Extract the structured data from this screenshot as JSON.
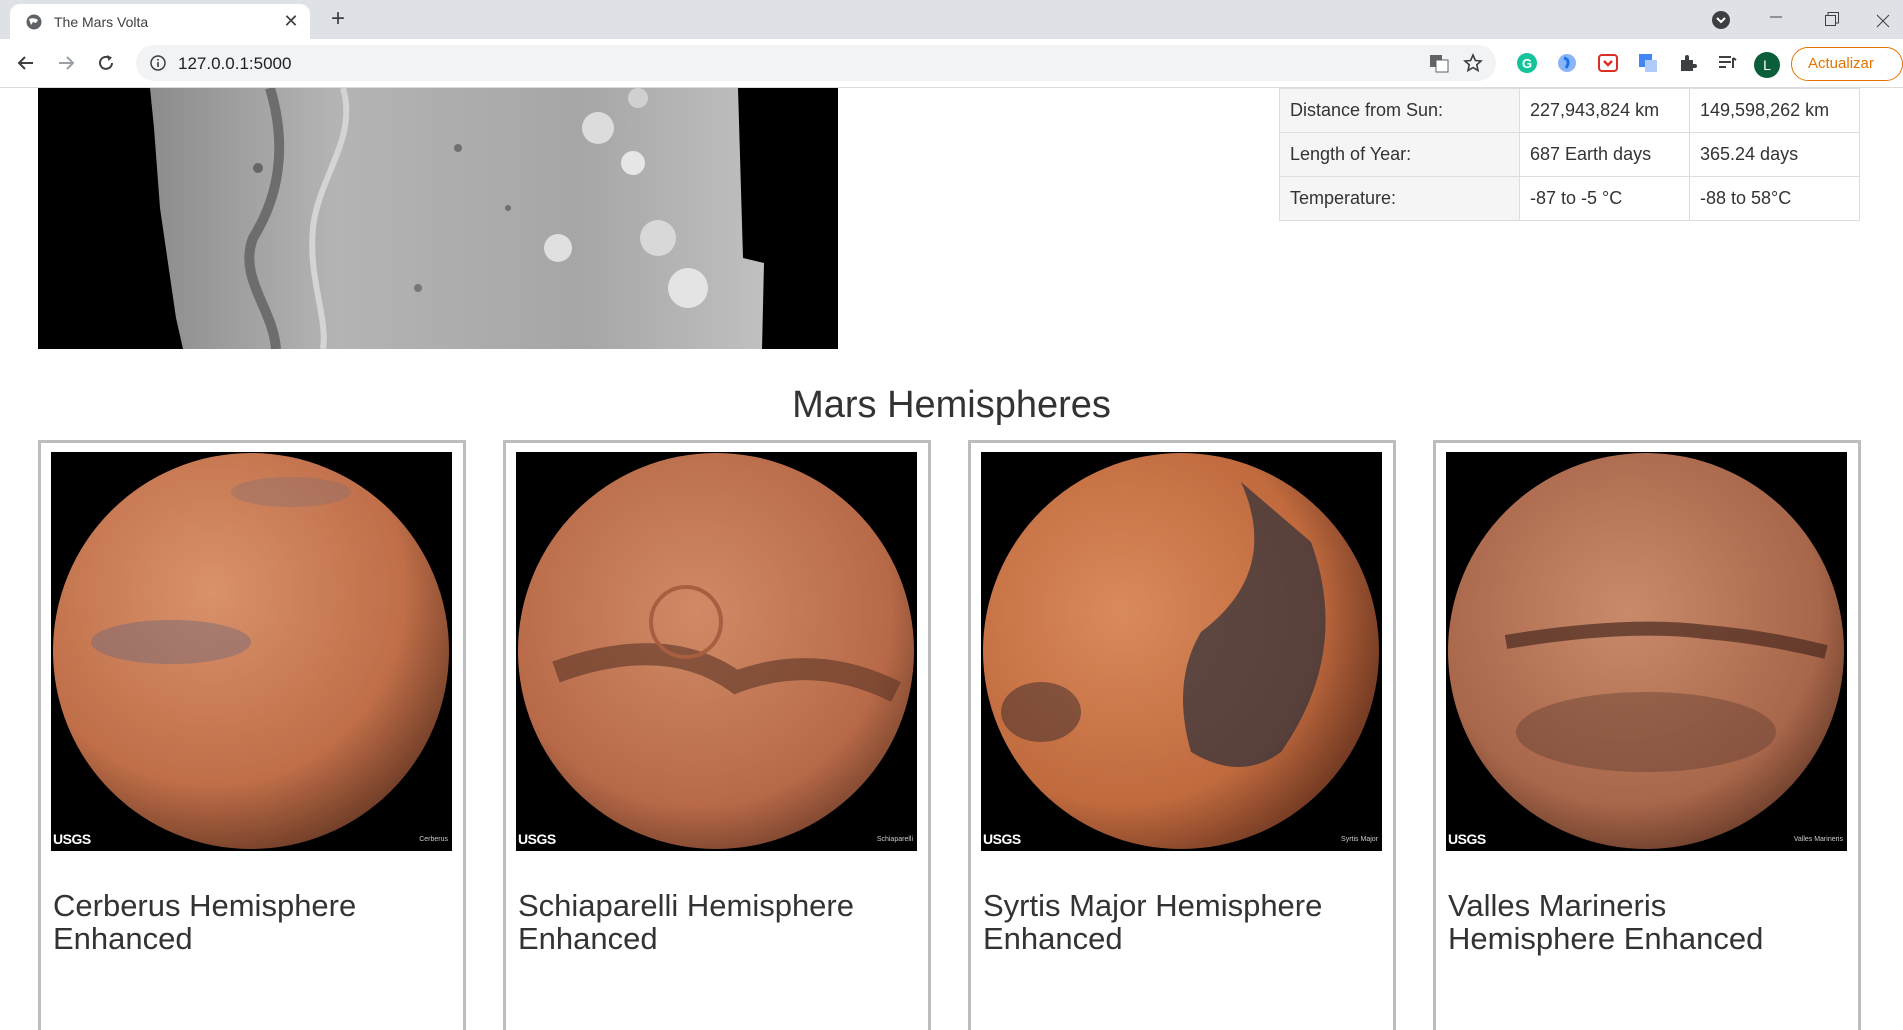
{
  "browser": {
    "tab_title": "The Mars Volta",
    "url": "127.0.0.1:5000",
    "update_label": "Actualizar",
    "avatar_initial": "L"
  },
  "facts_table": {
    "rows": [
      {
        "label": "Distance from Sun:",
        "mars": "227,943,824 km",
        "earth": "149,598,262 km"
      },
      {
        "label": "Length of Year:",
        "mars": "687 Earth days",
        "earth": "365.24 days"
      },
      {
        "label": "Temperature:",
        "mars": "-87 to -5 °C",
        "earth": "-88 to 58°C"
      }
    ]
  },
  "hemispheres": {
    "heading": "Mars Hemispheres",
    "items": [
      {
        "title": "Cerberus Hemisphere Enhanced",
        "image_label": "Cerberus",
        "logo": "USGS"
      },
      {
        "title": "Schiaparelli Hemisphere Enhanced",
        "image_label": "Schiaparelli",
        "logo": "USGS"
      },
      {
        "title": "Syrtis Major Hemisphere Enhanced",
        "image_label": "Syrtis Major",
        "logo": "USGS"
      },
      {
        "title": "Valles Marineris Hemisphere Enhanced",
        "image_label": "Valles Marineris",
        "logo": "USGS"
      }
    ]
  },
  "colors": {
    "mars_surface": "#c97a55",
    "mars_shadow": "#6b3a25",
    "chrome_bg": "#dee1e6",
    "update_accent": "#e37400"
  }
}
